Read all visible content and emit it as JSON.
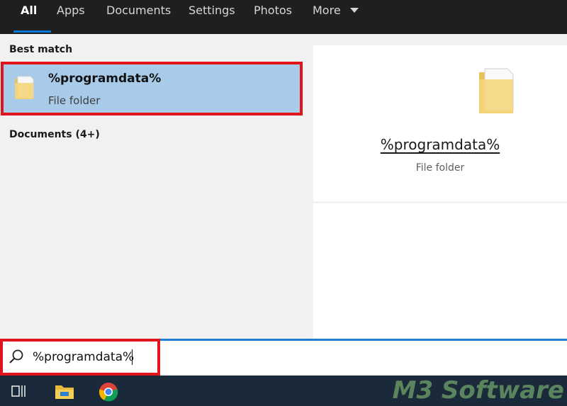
{
  "tabs": [
    {
      "label": "All",
      "active": true
    },
    {
      "label": "Apps"
    },
    {
      "label": "Documents"
    },
    {
      "label": "Settings"
    },
    {
      "label": "Photos"
    },
    {
      "label": "More"
    }
  ],
  "left": {
    "best_match_label": "Best match",
    "documents_label": "Documents (4+)",
    "result": {
      "title": "%programdata%",
      "subtitle": "File folder",
      "icon": "folder-icon"
    }
  },
  "preview": {
    "title": "%programdata%",
    "subtitle": "File folder",
    "icon": "folder-icon"
  },
  "search": {
    "value": "%programdata%",
    "icon": "search-icon"
  },
  "taskbar": {
    "icons": [
      "task-view-icon",
      "file-explorer-icon",
      "chrome-icon"
    ],
    "watermark": "M3 Software"
  },
  "colors": {
    "accent": "#0a78d7",
    "highlight": "#e0151b",
    "selected": "#a8cbea",
    "tabbar": "#1f1f1f",
    "taskbar": "#1b2a3a"
  }
}
